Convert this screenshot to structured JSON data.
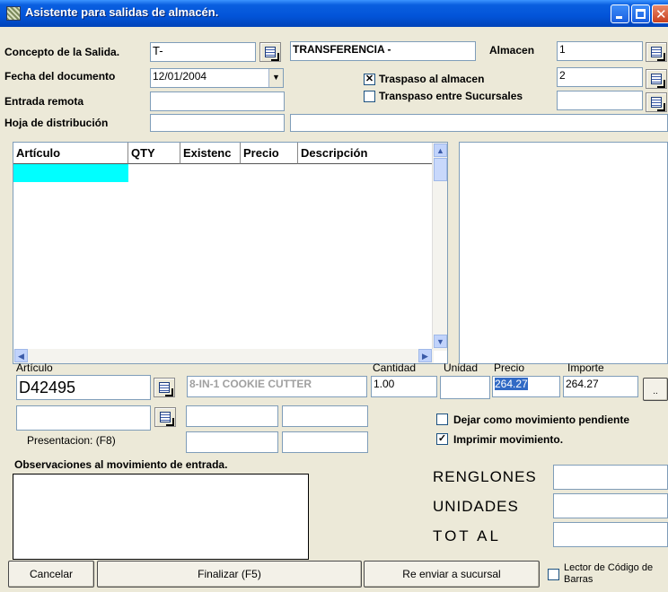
{
  "window": {
    "title": "Asistente para salidas de almacén."
  },
  "header": {
    "concepto_label": "Concepto de la Salida.",
    "concepto_value": "T-",
    "concepto_desc": "TRANSFERENCIA -",
    "almacen_label": "Almacen",
    "almacen_value": "1",
    "almacen2_value": "2",
    "almacen3_value": "",
    "fecha_label": "Fecha del documento",
    "fecha_value": "12/01/2004",
    "traspaso_almacen_label": "Traspaso al almacen",
    "traspaso_almacen_checked": true,
    "traspaso_sucursales_label": "Transpaso entre Sucursales",
    "traspaso_sucursales_checked": false,
    "entrada_label": "Entrada remota",
    "entrada_value": "",
    "hoja_label": "Hoja de distribución",
    "hoja_value": "",
    "hoja_desc": ""
  },
  "grid": {
    "columns": [
      "Artículo",
      "QTY",
      "Existenc",
      "Precio",
      "Descripción"
    ],
    "rows": []
  },
  "entry": {
    "articulo_label": "Artículo",
    "articulo_value": "D42495",
    "articulo_desc": "8-IN-1 COOKIE CUTTER",
    "cantidad_label": "Cantidad",
    "cantidad_value": "1.00",
    "unidad_label": "Unidad",
    "unidad_value": "",
    "precio_label": "Precio",
    "precio_value": "264.27",
    "importe_label": "Importe",
    "importe_value": "264.27",
    "ellipsis": "..",
    "presentacion_value": "",
    "presentacion_label": "Presentacion: (F8)"
  },
  "options": {
    "pendiente_label": "Dejar como movimiento pendiente",
    "pendiente_checked": false,
    "imprimir_label": "Imprimir movimiento.",
    "imprimir_checked": true
  },
  "observaciones": {
    "label": "Observaciones al movimiento de entrada.",
    "value": ""
  },
  "totals": {
    "renglones_label": "RENGLONES",
    "unidades_label": "UNIDADES",
    "total_label": "TOT AL",
    "renglones_value": "",
    "unidades_value": "",
    "total_value": ""
  },
  "buttons": {
    "cancelar": "Cancelar",
    "finalizar": "Finalizar (F5)",
    "reenviar": "Re enviar a sucursal",
    "lector_label": "Lector de Código de Barras"
  },
  "colors": {
    "titlebar": "#0254D8",
    "selection": "#316AC5",
    "row_highlight": "#00FFFF",
    "face": "#ECE9D8"
  }
}
